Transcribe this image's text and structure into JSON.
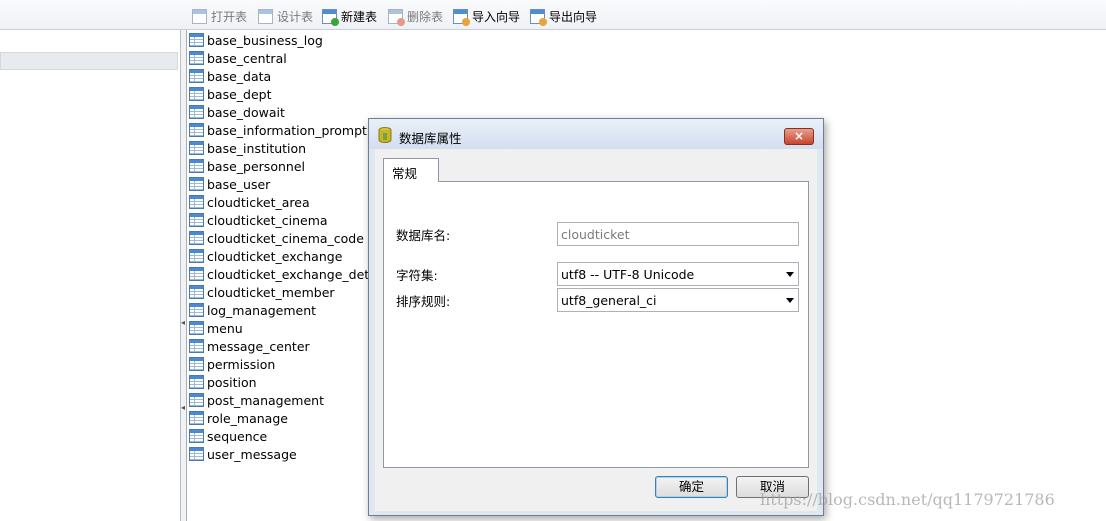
{
  "toolbar": {
    "buttons": [
      {
        "label": "打开表",
        "icon": "open-table-icon",
        "enabled": false
      },
      {
        "label": "设计表",
        "icon": "design-table-icon",
        "enabled": false
      },
      {
        "label": "新建表",
        "icon": "new-table-icon",
        "enabled": true
      },
      {
        "label": "删除表",
        "icon": "delete-table-icon",
        "enabled": false
      },
      {
        "label": "导入向导",
        "icon": "import-wizard-icon",
        "enabled": true
      },
      {
        "label": "导出向导",
        "icon": "export-wizard-icon",
        "enabled": true
      }
    ]
  },
  "tables": [
    "base_business_log",
    "base_central",
    "base_data",
    "base_dept",
    "base_dowait",
    "base_information_prompt",
    "base_institution",
    "base_personnel",
    "base_user",
    "cloudticket_area",
    "cloudticket_cinema",
    "cloudticket_cinema_code",
    "cloudticket_exchange",
    "cloudticket_exchange_detail",
    "cloudticket_member",
    "log_management",
    "menu",
    "message_center",
    "permission",
    "position",
    "post_management",
    "role_manage",
    "sequence",
    "user_message"
  ],
  "dialog": {
    "title": "数据库属性",
    "close_label": "×",
    "tab_label": "常规",
    "db_name_label": "数据库名:",
    "db_name_value": "cloudticket",
    "charset_label": "字符集:",
    "charset_value": "utf8 -- UTF-8 Unicode",
    "collation_label": "排序规则:",
    "collation_value": "utf8_general_ci",
    "ok_label": "确定",
    "cancel_label": "取消"
  },
  "watermark": "https://blog.csdn.net/qq1179721786",
  "colors": {
    "accent": "#4a8ad4",
    "close_button": "#c7452d",
    "dialog_frame": "#dfe7f1"
  }
}
